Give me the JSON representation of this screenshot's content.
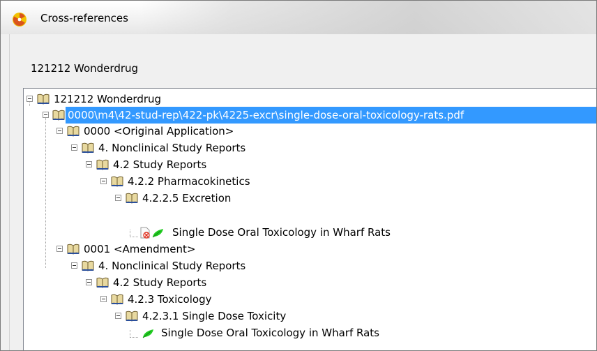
{
  "window": {
    "title": "Cross-references"
  },
  "product": {
    "label": "121212 Wonderdrug"
  },
  "tree": {
    "root": "121212 Wonderdrug",
    "selected_path": "0000\\m4\\42-stud-rep\\422-pk\\4225-excr\\single-dose-oral-toxicology-rats.pdf",
    "seq1": {
      "label": "0000 <Original Application>",
      "module": "4. Nonclinical Study Reports",
      "section": "4.2 Study Reports",
      "subsection": "4.2.2 Pharmacokinetics",
      "leafsection": "4.2.2.5 Excretion",
      "document": "Single Dose Oral Toxicology in Wharf Rats"
    },
    "seq2": {
      "label": "0001 <Amendment>",
      "module": "4. Nonclinical Study Reports",
      "section": "4.2 Study Reports",
      "subsection": "4.2.3 Toxicology",
      "leafsection": "4.2.3.1 Single Dose Toxicity",
      "document": "Single Dose Oral Toxicology in Wharf Rats"
    }
  },
  "colors": {
    "selection": "#3399ff",
    "leaf": "#22cc22",
    "error": "#e0301e"
  },
  "icons": {
    "app": "radiation-icon",
    "book": "book-icon",
    "document": "document-deleted-icon",
    "leaf": "leaf-icon"
  }
}
